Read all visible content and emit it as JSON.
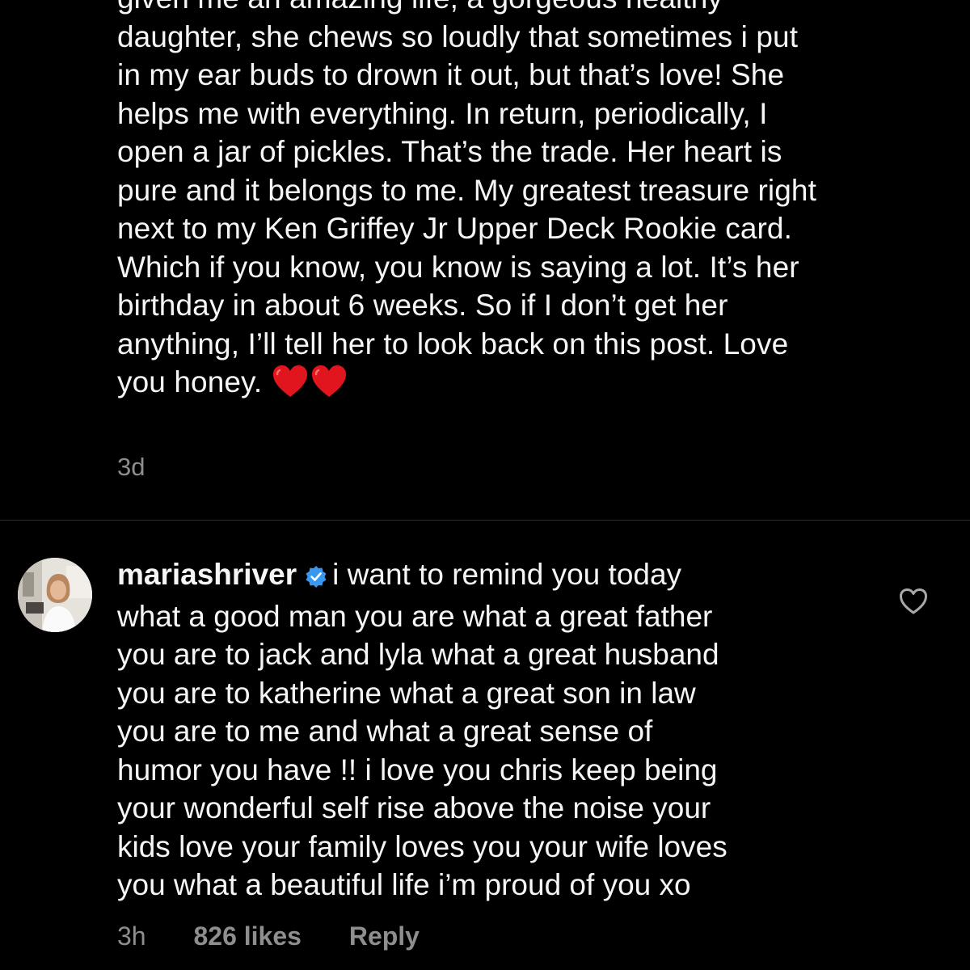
{
  "post_caption": {
    "lines": [
      "given me an amazing life, a gorgeous healthy",
      "daughter, she chews so loudly that sometimes i put",
      "in my ear buds to drown it out, but that’s love! She",
      "helps me with everything. In return, periodically, I",
      "open a jar of pickles. That’s the trade. Her heart is",
      "pure and it belongs to me. My greatest treasure right",
      "next to my Ken Griffey Jr Upper Deck Rookie card.",
      "Which if you know, you know is saying a lot. It’s her",
      "birthday in about 6 weeks. So if I don’t get her",
      "anything, I’ll tell her to look back on this post. Love",
      "you honey."
    ],
    "emoji": [
      "red-heart-icon",
      "red-heart-icon"
    ],
    "timestamp": "3d"
  },
  "comment": {
    "username": "mariashriver",
    "verified_icon": "verified-badge-icon",
    "first_line_text": "i want to remind you today",
    "lines": [
      "what a good man you are what a great father",
      "you are to jack and  lyla what a great husband",
      "you are to katherine  what a great son in law",
      "you are to me  and what a great sense of",
      "humor you have !! i love you chris keep being",
      "your wonderful self rise above the noise your",
      "kids love your family loves you your wife loves",
      "you what a beautiful life i’m proud of you xo"
    ],
    "timestamp": "3h",
    "likes": "826 likes",
    "reply_label": "Reply",
    "like_icon": "heart-outline-icon"
  },
  "colors": {
    "background": "#000000",
    "text": "#f5f5f5",
    "secondary_text": "#8e8e8e",
    "verified_blue": "#3897f0",
    "emoji_red": "#e0151d"
  }
}
